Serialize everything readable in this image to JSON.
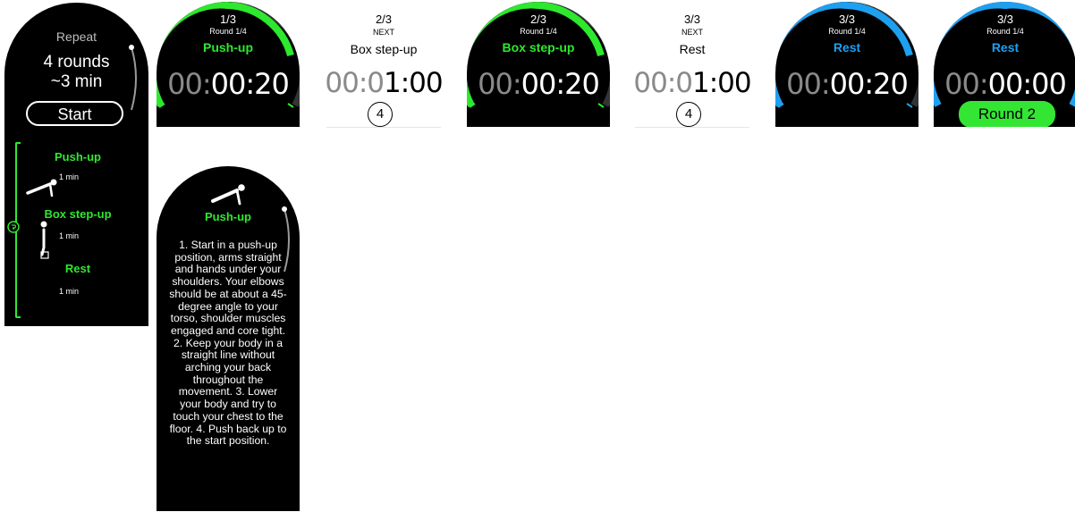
{
  "colors": {
    "active_green": "#2ee82e",
    "rest_blue": "#1ea0f0",
    "background": "#000000"
  },
  "overview": {
    "repeat_label": "Repeat",
    "rounds": "4 rounds",
    "approx": "~3 min",
    "start_label": "Start",
    "exercises": [
      {
        "name": "Push-up",
        "duration": "1 min",
        "icon": "push-up-icon"
      },
      {
        "name": "Box step-up",
        "duration": "1 min",
        "icon": "box-step-up-icon"
      },
      {
        "name": "Rest",
        "duration": "1 min"
      }
    ]
  },
  "screens": [
    {
      "count": "1/3",
      "round": "Round 1/4",
      "name": "Push-up",
      "time_dim": "00:",
      "time_bright": "00:20",
      "color": "#2ee82e"
    },
    {
      "count": "2/3",
      "next_label": "NEXT",
      "name": "Box step-up",
      "time_dim": "00:0",
      "time_bright": "1:00",
      "countdown": "4"
    },
    {
      "count": "2/3",
      "round": "Round 1/4",
      "name": "Box step-up",
      "time_dim": "00:",
      "time_bright": "00:20",
      "color": "#2ee82e"
    },
    {
      "count": "3/3",
      "next_label": "NEXT",
      "name": "Rest",
      "time_dim": "00:0",
      "time_bright": "1:00",
      "countdown": "4"
    },
    {
      "count": "3/3",
      "round": "Round 1/4",
      "name": "Rest",
      "time_dim": "00:",
      "time_bright": "00:20",
      "color": "#1ea0f0"
    },
    {
      "count": "3/3",
      "round": "Round 1/4",
      "name": "Rest",
      "time_dim": "00:",
      "time_bright": "00:00",
      "color": "#1ea0f0",
      "button_label": "Round 2"
    }
  ],
  "detail": {
    "title": "Push-up",
    "instructions": "1. Start in a push-up position, arms straight and hands under your shoulders. Your elbows should be at about a 45-degree angle to your torso, shoulder muscles engaged and core tight. 2. Keep your body in a straight line without arching your back throughout the movement. 3. Lower your body and try to touch your chest to the floor. 4. Push back up to the start position."
  }
}
